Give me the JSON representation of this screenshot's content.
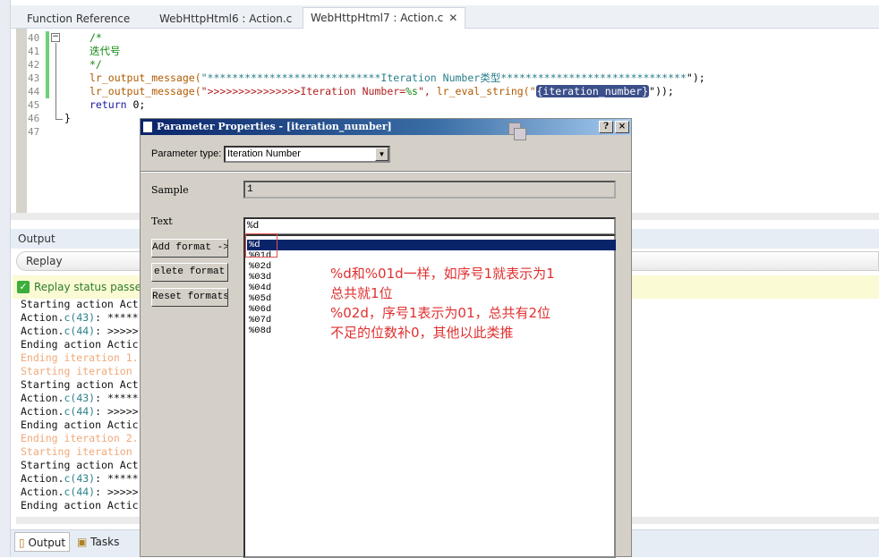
{
  "tabs": [
    {
      "label": "Function Reference"
    },
    {
      "label": "WebHttpHtml6 : Action.c"
    },
    {
      "label": "WebHttpHtml7 : Action.c",
      "active": true
    }
  ],
  "editor": {
    "line_numbers": [
      "40",
      "41",
      "42",
      "43",
      "44",
      "45",
      "46",
      "47"
    ],
    "lines": {
      "l40": "/*",
      "l41": "迭代号",
      "l42": "*/",
      "l43_fn": "lr_output_message(",
      "l43_str1": "\"****************************",
      "l43_str2": "Iteration Number类型******************************",
      "l43_end": "\");",
      "l44_fn": "lr_output_message(",
      "l44_str": "\">>>>>>>>>>>>>>>Iteration Number=",
      "l44_fmt": "%s",
      "l44_mid": "\", ",
      "l44_fn2": "lr_eval_string(\"",
      "l44_param": "{iteration_number}",
      "l44_end": "\"));",
      "l45_kw": "return",
      "l45_rest": " 0;",
      "l46": "}"
    }
  },
  "output": {
    "title": "Output",
    "filter": "Replay",
    "status": "Replay status passe",
    "log": [
      {
        "text": "Starting action Act",
        "type": "normal"
      },
      {
        "pre": "Action.",
        "num": "c(43)",
        "post": ": *****",
        "type": "normal"
      },
      {
        "pre": "Action.",
        "num": "c(44)",
        "post": ": >>>>>",
        "type": "normal"
      },
      {
        "text": "Ending action Actic",
        "type": "normal"
      },
      {
        "text": "Ending iteration 1.",
        "type": "iter"
      },
      {
        "text": "Starting iteration ",
        "type": "iter"
      },
      {
        "text": "Starting action Act",
        "type": "normal"
      },
      {
        "pre": "Action.",
        "num": "c(43)",
        "post": ": *****",
        "type": "normal"
      },
      {
        "pre": "Action.",
        "num": "c(44)",
        "post": ": >>>>>",
        "type": "normal"
      },
      {
        "text": "Ending action Actic",
        "type": "normal"
      },
      {
        "text": "Ending iteration 2.",
        "type": "iter"
      },
      {
        "text": "Starting iteration ",
        "type": "iter"
      },
      {
        "text": "Starting action Act",
        "type": "normal"
      },
      {
        "pre": "Action.",
        "num": "c(43)",
        "post": ": *****",
        "type": "normal"
      },
      {
        "pre": "Action.",
        "num": "c(44)",
        "post": ": >>>>>",
        "type": "normal"
      },
      {
        "text": "Ending action Actic",
        "type": "normal"
      }
    ],
    "bottom_tabs": [
      {
        "label": "Output"
      },
      {
        "label": "Tasks"
      }
    ]
  },
  "dialog": {
    "title": "Parameter Properties - [iteration_number]",
    "help": "?",
    "close": "×",
    "param_type_label": "Parameter type:",
    "param_type_value": "Iteration Number",
    "sample_label": "Sample",
    "sample_value": "1",
    "text_label": "Text",
    "text_value": "%d",
    "add_format": "Add format ->",
    "delete_format": "elete format <",
    "reset_formats": "Reset formats",
    "formats": [
      "%d",
      "%01d",
      "%02d",
      "%03d",
      "%04d",
      "%05d",
      "%06d",
      "%07d",
      "%08d"
    ],
    "selected_format": "%d"
  },
  "annotation": {
    "lines": [
      "%d和%01d一样，如序号1就表示为1",
      "总共就1位",
      "%02d，序号1表示为01，总共有2位",
      "不足的位数补0，其他以此类推"
    ],
    "color": "#e03030"
  }
}
